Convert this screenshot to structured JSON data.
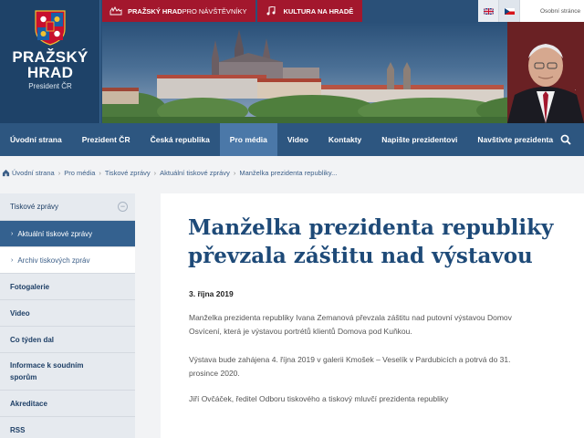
{
  "header": {
    "logo_title_line1": "PRAŽSKÝ",
    "logo_title_line2": "HRAD",
    "logo_subtitle": "President ČR",
    "toplinks": [
      {
        "strong": "PRAŽSKÝ HRAD",
        "rest": " PRO NÁVŠTĚVNÍKY"
      },
      {
        "strong": "KULTURA NA HRADĚ",
        "rest": ""
      }
    ],
    "languages": [
      "en-flag",
      "cz-flag"
    ],
    "personal_settings": "Osobní stránce",
    "colors": {
      "primary": "#2d5680",
      "accent": "#a3172d",
      "title": "#1e4a78"
    }
  },
  "nav": {
    "items": [
      "Úvodní strana",
      "Prezident ČR",
      "Česká republika",
      "Pro média",
      "Video",
      "Kontakty",
      "Napište prezidentovi",
      "Navštivte prezidenta"
    ],
    "active": "Pro média"
  },
  "breadcrumb": [
    "Úvodní strana",
    "Pro média",
    "Tiskové zprávy",
    "Aktuální tiskové zprávy",
    "Manželka prezidenta republiky..."
  ],
  "sidebar": {
    "section": "Tiskové zprávy",
    "sub_active": "Aktuální tiskové zprávy",
    "sub": "Archiv tiskových zpráv",
    "items": [
      "Fotogalerie",
      "Video",
      "Co týden dal"
    ],
    "tall_item_line1": "Informace k soudním",
    "tall_item_line2": "sporům",
    "items2": [
      "Akreditace",
      "RSS"
    ]
  },
  "article": {
    "title_line1": "Manželka prezidenta republiky",
    "title_line2": "převzala záštitu nad výstavou",
    "date": "3. října 2019",
    "p1_line1": "Manželka prezidenta republiky Ivana Zemanová převzala záštitu nad putovní výstavou Domov",
    "p1_line2": "Osvícení, která je výstavou portrétů klientů Domova pod Kuňkou.",
    "p2_line1": "Výstava bude zahájena 4. října 2019 v galerii Kmošek – Veselík v Pardubicích a potrvá do 31.",
    "p2_line2": "prosince 2020.",
    "p3": "Jiří Ovčáček, ředitel Odboru tiskového a tiskový mluvčí prezidenta republiky"
  }
}
